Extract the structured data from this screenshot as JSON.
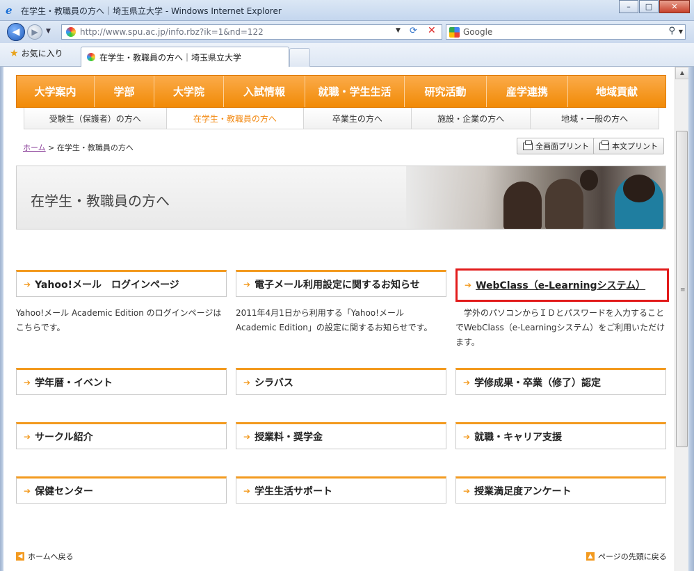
{
  "window": {
    "title": "在学生・教職員の方へ｜埼玉県立大学 - Windows Internet Explorer",
    "controls": [
      "–",
      "□",
      "✕"
    ]
  },
  "toolbar": {
    "url": "http://www.spu.ac.jp/info.rbz?ik=1&nd=122",
    "search_placeholder": "Google"
  },
  "favbar": {
    "favorites_label": "お気に入り",
    "tab_label": "在学生・教職員の方へ｜埼玉県立大学"
  },
  "site": {
    "global_nav": [
      "大学案内",
      "学部",
      "大学院",
      "入試情報",
      "就職・学生生活",
      "研究活動",
      "産学連携",
      "地域貢献"
    ],
    "sub_nav": [
      {
        "label": "受験生（保護者）の方へ",
        "active": false
      },
      {
        "label": "在学生・教職員の方へ",
        "active": true
      },
      {
        "label": "卒業生の方へ",
        "active": false
      },
      {
        "label": "施設・企業の方へ",
        "active": false
      },
      {
        "label": "地域・一般の方へ",
        "active": false
      }
    ],
    "breadcrumb": {
      "home": "ホーム",
      "separator": ">",
      "current": "在学生・教職員の方へ"
    },
    "print_full": "全画面プリント",
    "print_body": "本文プリント",
    "hero_title": "在学生・教職員の方へ",
    "cards": [
      {
        "label": "Yahoo!メール　ログインページ",
        "desc": "Yahoo!メール Academic Edition のログインページはこちらです。"
      },
      {
        "label": "電子メール利用設定に関するお知らせ",
        "desc": "2011年4月1日から利用する「Yahoo!メール Academic Edition」の設定に関するお知らせです。"
      },
      {
        "label": "WebClass（e-Learningシステム）",
        "desc": "　学外のパソコンからＩＤとパスワードを入力することでWebClass（e-Learningシステム）をご利用いただけます。"
      },
      {
        "label": "学年暦・イベント"
      },
      {
        "label": "シラバス"
      },
      {
        "label": "学修成果・卒業（修了）認定"
      },
      {
        "label": "サークル紹介"
      },
      {
        "label": "授業料・奨学金"
      },
      {
        "label": "就職・キャリア支援"
      },
      {
        "label": "保健センター"
      },
      {
        "label": "学生生活サポート"
      },
      {
        "label": "授業満足度アンケート"
      }
    ],
    "footer_home": "ホームへ戻る",
    "footer_top": "ページの先頭に戻る"
  },
  "colors": {
    "accent": "#f18a06",
    "highlight": "#e21b1b"
  }
}
